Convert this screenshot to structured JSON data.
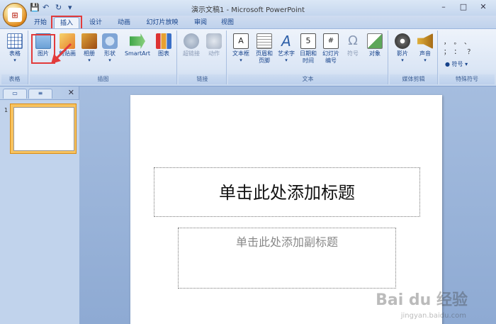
{
  "window": {
    "title": "演示文稿1 - Microsoft PowerPoint"
  },
  "tabs": [
    {
      "label": "开始"
    },
    {
      "label": "插入"
    },
    {
      "label": "设计"
    },
    {
      "label": "动画"
    },
    {
      "label": "幻灯片放映"
    },
    {
      "label": "审阅"
    },
    {
      "label": "视图"
    }
  ],
  "ribbon": {
    "groups": {
      "tables": "表格",
      "illustrations": "插图",
      "links": "链接",
      "text": "文本",
      "media": "媒体剪辑",
      "symbols": "特殊符号"
    },
    "buttons": {
      "table": "表格",
      "picture": "图片",
      "clipart": "剪贴画",
      "album": "相册",
      "shapes": "形状",
      "smartart": "SmartArt",
      "chart": "图表",
      "hyperlink": "超链接",
      "action": "动作",
      "textbox": "文本框",
      "header_footer_1": "页眉和",
      "header_footer_2": "页脚",
      "wordart": "艺术字",
      "datetime_1": "日期和",
      "datetime_2": "时间",
      "slide_number_1": "幻灯片",
      "slide_number_2": "编号",
      "symbol": "符号",
      "object": "对象",
      "movie": "影片",
      "sound": "声音",
      "special_symbol": "符号"
    }
  },
  "slide_pane": {
    "slide_number": "1"
  },
  "slide": {
    "title_placeholder": "单击此处添加标题",
    "subtitle_placeholder": "单击此处添加副标题"
  },
  "watermark": {
    "brand": "Bai du 经验",
    "url": "jingyan.baidu.com"
  },
  "colors": {
    "highlight": "#e23b3b",
    "ribbon": "#dbe6f5",
    "workspace": "#a5bddf"
  }
}
